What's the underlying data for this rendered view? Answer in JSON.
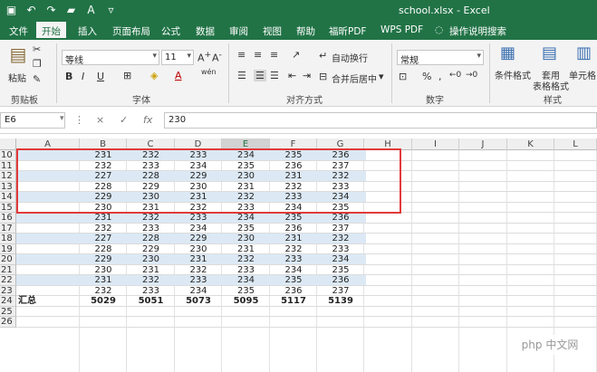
{
  "window": {
    "title": "school.xlsx  -  Excel",
    "qat_icons": [
      "save-icon",
      "undo-icon",
      "redo-icon",
      "folder-icon",
      "font-color-icon",
      "customize-icon"
    ]
  },
  "tabs": [
    "文件",
    "开始",
    "插入",
    "页面布局",
    "公式",
    "数据",
    "审阅",
    "视图",
    "帮助",
    "福昕PDF",
    "WPS PDF",
    "操作说明搜索"
  ],
  "active_tab": "开始",
  "ribbon": {
    "clipboard_label": "剪贴板",
    "paste_label": "粘贴",
    "font_label": "字体",
    "font_name": "等线",
    "font_size": "11",
    "bold": "B",
    "italic": "I",
    "underline": "U",
    "wen": "wén",
    "align_label": "对齐方式",
    "wrap_text": "自动换行",
    "merge_center": "合并后居中",
    "number_label": "数字",
    "number_format": "常规",
    "style_label": "样式",
    "conditional_format": "条件格式",
    "table_format_1": "套用",
    "table_format_2": "表格格式",
    "cell_style": "单元格"
  },
  "formula_bar": {
    "name_box": "E6",
    "fx": "fx",
    "cancel": "×",
    "enter": "✓",
    "value": "230"
  },
  "columns": [
    "A",
    "B",
    "C",
    "D",
    "E",
    "F",
    "G",
    "H",
    "I",
    "J",
    "K",
    "L"
  ],
  "selected_column": "E",
  "rows": [
    {
      "n": "10",
      "a": "",
      "v": [
        "231",
        "232",
        "233",
        "234",
        "235",
        "236"
      ]
    },
    {
      "n": "11",
      "a": "",
      "v": [
        "232",
        "233",
        "234",
        "235",
        "236",
        "237"
      ]
    },
    {
      "n": "12",
      "a": "",
      "v": [
        "227",
        "228",
        "229",
        "230",
        "231",
        "232"
      ]
    },
    {
      "n": "13",
      "a": "",
      "v": [
        "228",
        "229",
        "230",
        "231",
        "232",
        "233"
      ]
    },
    {
      "n": "14",
      "a": "",
      "v": [
        "229",
        "230",
        "231",
        "232",
        "233",
        "234"
      ]
    },
    {
      "n": "15",
      "a": "",
      "v": [
        "230",
        "231",
        "232",
        "233",
        "234",
        "235"
      ]
    },
    {
      "n": "16",
      "a": "",
      "v": [
        "231",
        "232",
        "233",
        "234",
        "235",
        "236"
      ]
    },
    {
      "n": "17",
      "a": "",
      "v": [
        "232",
        "233",
        "234",
        "235",
        "236",
        "237"
      ]
    },
    {
      "n": "18",
      "a": "",
      "v": [
        "227",
        "228",
        "229",
        "230",
        "231",
        "232"
      ]
    },
    {
      "n": "19",
      "a": "",
      "v": [
        "228",
        "229",
        "230",
        "231",
        "232",
        "233"
      ]
    },
    {
      "n": "20",
      "a": "",
      "v": [
        "229",
        "230",
        "231",
        "232",
        "233",
        "234"
      ]
    },
    {
      "n": "21",
      "a": "",
      "v": [
        "230",
        "231",
        "232",
        "233",
        "234",
        "235"
      ]
    },
    {
      "n": "22",
      "a": "",
      "v": [
        "231",
        "232",
        "233",
        "234",
        "235",
        "236"
      ]
    },
    {
      "n": "23",
      "a": "",
      "v": [
        "232",
        "233",
        "234",
        "235",
        "236",
        "237"
      ]
    },
    {
      "n": "24",
      "a": "汇总",
      "v": [
        "5029",
        "5051",
        "5073",
        "5095",
        "5117",
        "5139"
      ]
    },
    {
      "n": "25",
      "a": "",
      "v": [
        "",
        "",
        "",
        "",
        "",
        ""
      ]
    },
    {
      "n": "26",
      "a": "",
      "v": [
        "",
        "",
        "",
        "",
        "",
        ""
      ]
    }
  ],
  "watermark": "php 中文网",
  "colors": {
    "excel_green": "#217346",
    "band": "#dce9f5",
    "highlight_border": "#e23a3a"
  }
}
